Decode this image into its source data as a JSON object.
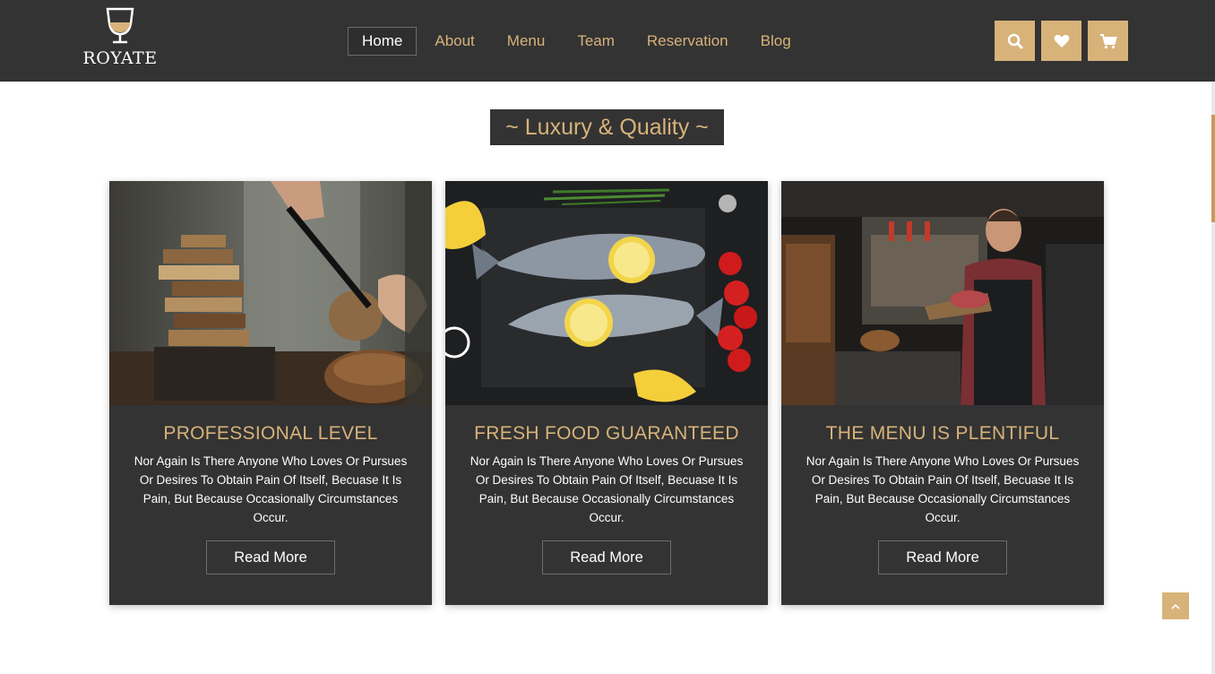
{
  "brand": {
    "name": "ROYATE"
  },
  "nav": {
    "items": [
      {
        "label": "Home",
        "active": true
      },
      {
        "label": "About"
      },
      {
        "label": "Menu"
      },
      {
        "label": "Team"
      },
      {
        "label": "Reservation"
      },
      {
        "label": "Blog"
      }
    ]
  },
  "header_icons": [
    "search-icon",
    "heart-icon",
    "cart-icon"
  ],
  "section": {
    "title": "~ Luxury & Quality ~"
  },
  "cards": [
    {
      "title": "PROFESSIONAL LEVEL",
      "text": "Nor Again Is There Anyone Who Loves Or Pursues Or Desires To Obtain Pain Of Itself, Becuase It Is Pain, But Because Occasionally Circumstances Occur.",
      "button": "Read More"
    },
    {
      "title": "FRESH FOOD GUARANTEED",
      "text": "Nor Again Is There Anyone Who Loves Or Pursues Or Desires To Obtain Pain Of Itself, Becuase It Is Pain, But Because Occasionally Circumstances Occur.",
      "button": "Read More"
    },
    {
      "title": "THE MENU IS PLENTIFUL",
      "text": "Nor Again Is There Anyone Who Loves Or Pursues Or Desires To Obtain Pain Of Itself, Becuase It Is Pain, But Because Occasionally Circumstances Occur.",
      "button": "Read More"
    }
  ],
  "colors": {
    "dark": "#333333",
    "accent": "#d7b37a",
    "text_light": "#ffffff"
  }
}
